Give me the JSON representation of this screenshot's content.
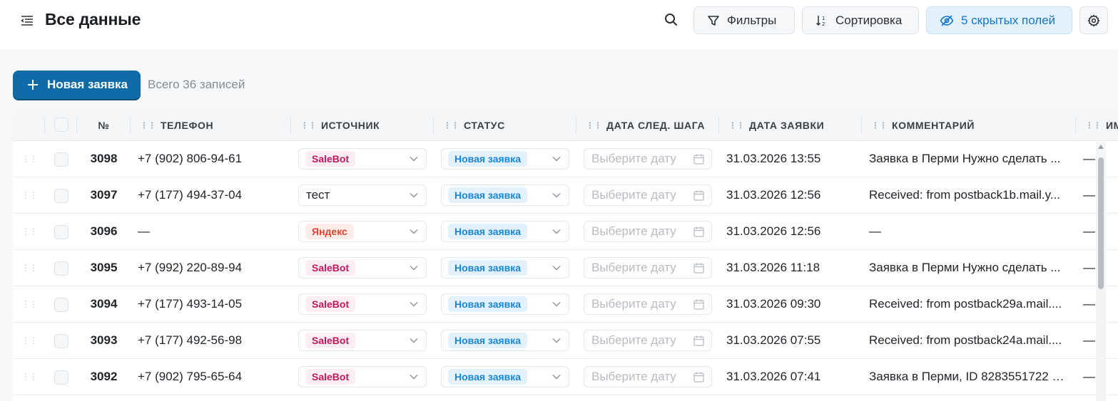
{
  "header": {
    "title": "Все данные",
    "filters_label": "Фильтры",
    "sort_label": "Сортировка",
    "hidden_fields_label": "5 скрытых полей"
  },
  "toolbar": {
    "new_request_label": "Новая заявка",
    "records_count": "Всего 36 записей"
  },
  "table": {
    "columns": [
      "№",
      "ТЕЛЕФОН",
      "ИСТОЧНИК",
      "СТАТУС",
      "ДАТА СЛЕД. ШАГА",
      "ДАТА ЗАЯВКИ",
      "КОММЕНТАРИЙ",
      "ИМ"
    ],
    "date_placeholder": "Выберите дату",
    "rows": [
      {
        "num": "3098",
        "phone": "+7 (902) 806-94-61",
        "source": "SaleBot",
        "status": "Новая заявка",
        "request_date": "31.03.2026 13:55",
        "comment": "Заявка в Перми Нужно сделать ...",
        "extra": "—"
      },
      {
        "num": "3097",
        "phone": "+7 (177) 494-37-04",
        "source": "тест",
        "status": "Новая заявка",
        "request_date": "31.03.2026 12:56",
        "comment": "Received: from postback1b.mail.y...",
        "extra": "—"
      },
      {
        "num": "3096",
        "phone": "—",
        "source": "Яндекс",
        "status": "Новая заявка",
        "request_date": "31.03.2026 12:56",
        "comment": "—",
        "extra": "—"
      },
      {
        "num": "3095",
        "phone": "+7 (992) 220-89-94",
        "source": "SaleBot",
        "status": "Новая заявка",
        "request_date": "31.03.2026 11:18",
        "comment": "Заявка в Перми Нужно сделать ...",
        "extra": "—"
      },
      {
        "num": "3094",
        "phone": "+7 (177) 493-14-05",
        "source": "SaleBot",
        "status": "Новая заявка",
        "request_date": "31.03.2026 09:30",
        "comment": "Received: from postback29a.mail....",
        "extra": "—"
      },
      {
        "num": "3093",
        "phone": "+7 (177) 492-56-98",
        "source": "SaleBot",
        "status": "Новая заявка",
        "request_date": "31.03.2026 07:55",
        "comment": "Received: from postback24a.mail....",
        "extra": "—"
      },
      {
        "num": "3092",
        "phone": "+7 (902) 795-65-64",
        "source": "SaleBot",
        "status": "Новая заявка",
        "request_date": "31.03.2026 07:41",
        "comment": "Заявка в Перми, ID 8283551722 Н...",
        "extra": "—"
      }
    ]
  },
  "colors": {
    "accent": "#0e6ba8",
    "status_blue": "#1a86d6",
    "salebot_pink": "#c2185b",
    "yandex_red": "#e0452f"
  }
}
